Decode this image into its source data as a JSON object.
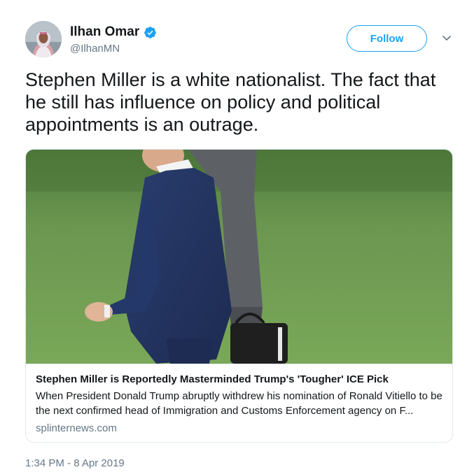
{
  "author": {
    "name": "Ilhan Omar",
    "handle": "@IlhanMN",
    "verified": true
  },
  "follow_button": {
    "label": "Follow"
  },
  "tweet": {
    "text": "Stephen Miller is a white nationalist. The fact that he still has influence on policy and political appointments is an outrage."
  },
  "card": {
    "title": "Stephen Miller is Reportedly Masterminded Trump's 'Tougher' ICE Pick",
    "description": "When President Donald Trump abruptly withdrew his nomination of Ronald Vitiello to be the next confirmed head of Immigration and Customs Enforcement agency on F...",
    "domain": "splinternews.com"
  },
  "timestamp": "1:34 PM - 8 Apr 2019",
  "icons": {
    "verified": "verified-badge-icon",
    "caret": "chevron-down-icon"
  },
  "colors": {
    "accent": "#1da1f2",
    "text": "#14171a",
    "secondary": "#657786",
    "border": "#e1e8ed"
  }
}
